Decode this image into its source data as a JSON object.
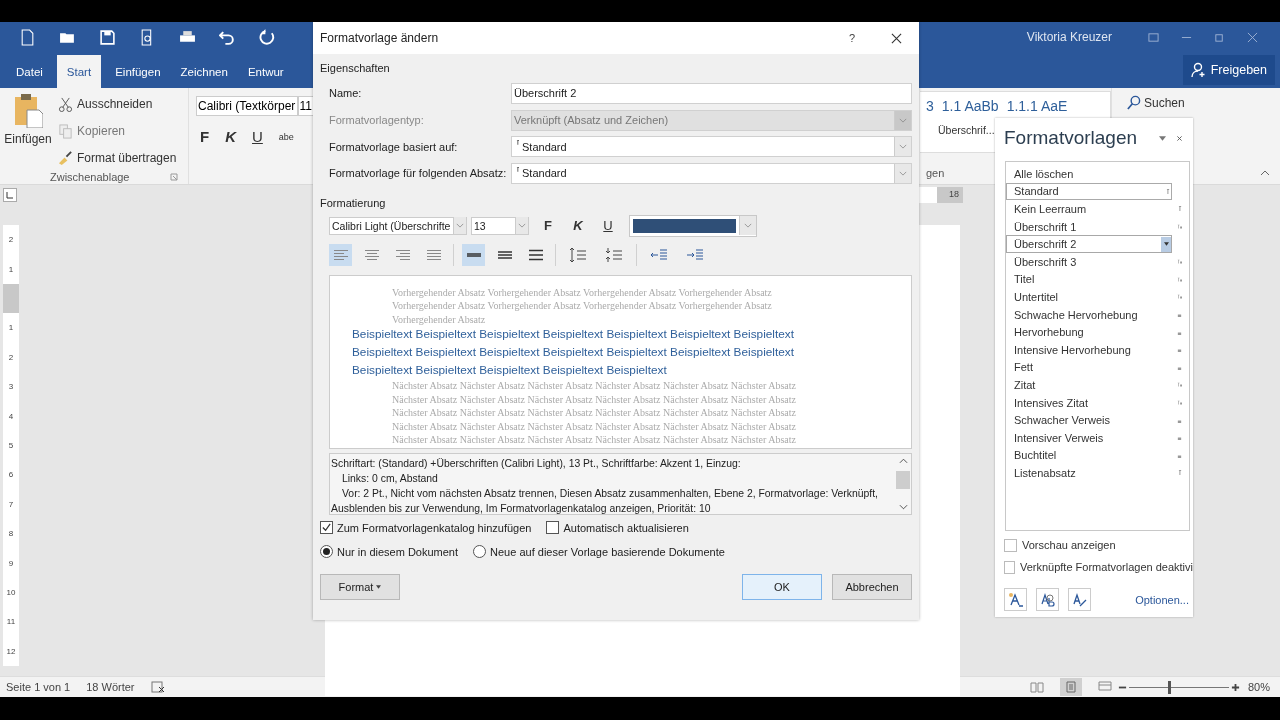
{
  "window": {
    "user": "Viktoria Kreuzer"
  },
  "ribbon_tabs": [
    {
      "label": "Datei",
      "selected": false
    },
    {
      "label": "Start",
      "selected": true
    },
    {
      "label": "Einfügen",
      "selected": false
    },
    {
      "label": "Zeichnen",
      "selected": false
    },
    {
      "label": "Entwur",
      "selected": false
    }
  ],
  "share_button": "Freigeben",
  "clipboard": {
    "paste": "Einfügen",
    "cut": "Ausschneiden",
    "copy": "Kopieren",
    "format_painter": "Format übertragen",
    "group_label": "Zwischenablage"
  },
  "font": {
    "name": "Calibri (Textkörper",
    "size": "11",
    "bold": "F",
    "italic": "K",
    "underline": "U",
    "strikethrough": "abe"
  },
  "style_gallery": {
    "previews": [
      "3",
      "1.1 AaBb",
      "1.1.1 AaE"
    ],
    "caption": "Überschrif...",
    "group_label": "gen"
  },
  "search": "Suchen",
  "ruler": {
    "mark": "18",
    "top_numbers": [
      "2",
      "1"
    ],
    "body_numbers": [
      "1",
      "2",
      "3",
      "4",
      "5",
      "6",
      "7",
      "8",
      "9",
      "10",
      "11",
      "12"
    ]
  },
  "dialog": {
    "title": "Formatvorlage ändern",
    "help": "?",
    "properties_heading": "Eigenschaften",
    "properties": [
      {
        "label": "Name:",
        "value": "Überschrift 2",
        "kind": "text",
        "disabled": false
      },
      {
        "label": "Formatvorlagentyp:",
        "value": "Verknüpft (Absatz und Zeichen)",
        "kind": "select",
        "disabled": true
      },
      {
        "label": "Formatvorlage basiert auf:",
        "value": "Standard",
        "kind": "style-select",
        "disabled": false
      },
      {
        "label": "Formatvorlage für folgenden Absatz:",
        "value": "Standard",
        "kind": "style-select",
        "disabled": false
      }
    ],
    "formatting_heading": "Formatierung",
    "font_name": "Calibri Light (Überschrifte",
    "font_size": "13",
    "bold": "F",
    "italic": "K",
    "underline": "U",
    "alignment_buttons": [
      {
        "kind": "left",
        "selected": true
      },
      {
        "kind": "center",
        "selected": false
      },
      {
        "kind": "right",
        "selected": false
      },
      {
        "kind": "justify",
        "selected": false
      }
    ],
    "spacing_buttons": [
      {
        "kind": "single",
        "selected": true
      },
      {
        "kind": "onehalf",
        "selected": false
      },
      {
        "kind": "double",
        "selected": false
      }
    ],
    "preview": {
      "previous_lines": [
        "Vorhergehender Absatz Vorhergehender Absatz Vorhergehender Absatz Vorhergehender Absatz",
        "Vorhergehender Absatz Vorhergehender Absatz Vorhergehender Absatz Vorhergehender Absatz",
        "Vorhergehender Absatz"
      ],
      "sample_lines": [
        "Beispieltext Beispieltext Beispieltext Beispieltext Beispieltext Beispieltext Beispieltext",
        "Beispieltext Beispieltext Beispieltext Beispieltext Beispieltext Beispieltext Beispieltext",
        "Beispieltext Beispieltext Beispieltext Beispieltext Beispieltext"
      ],
      "next_lines": [
        "Nächster Absatz Nächster Absatz Nächster Absatz Nächster Absatz Nächster Absatz Nächster Absatz",
        "Nächster Absatz Nächster Absatz Nächster Absatz Nächster Absatz Nächster Absatz Nächster Absatz",
        "Nächster Absatz Nächster Absatz Nächster Absatz Nächster Absatz Nächster Absatz Nächster Absatz",
        "Nächster Absatz Nächster Absatz Nächster Absatz Nächster Absatz Nächster Absatz Nächster Absatz",
        "Nächster Absatz Nächster Absatz Nächster Absatz Nächster Absatz Nächster Absatz Nächster Absatz"
      ]
    },
    "description_lines": [
      {
        "text": "Schriftart: (Standard) +Überschriften (Calibri Light), 13 Pt., Schriftfarbe: Akzent 1, Einzug:",
        "kind": "plain"
      },
      {
        "text": "Links:  0 cm, Abstand",
        "kind": "indented"
      },
      {
        "text": "Vor:  2 Pt., Nicht vom nächsten Absatz trennen, Diesen Absatz zusammenhalten, Ebene 2, Formatvorlage: Verknüpft,",
        "kind": "indented"
      },
      {
        "text": "Ausblenden bis zur Verwendung, Im Formatvorlagenkatalog anzeigen, Priorität: 10",
        "kind": "plain"
      }
    ],
    "checkboxes": [
      {
        "label": "Zum Formatvorlagenkatalog hinzufügen",
        "checked": true
      },
      {
        "label": "Automatisch aktualisieren",
        "checked": false
      }
    ],
    "radios": [
      {
        "label": "Nur in diesem Dokument",
        "selected": true
      },
      {
        "label": "Neue auf dieser Vorlage basierende Dokumente",
        "selected": false
      }
    ],
    "format_button": "Format",
    "ok_button": "OK",
    "cancel_button": "Abbrechen"
  },
  "styles_pane": {
    "title": "Formatvorlagen",
    "styles": [
      {
        "name": "Alle löschen",
        "kind": "command",
        "selected": false,
        "hovered": false
      },
      {
        "name": "Standard",
        "kind": "paragraph",
        "selected": false,
        "hovered": true
      },
      {
        "name": "Kein Leerraum",
        "kind": "paragraph",
        "selected": false,
        "hovered": false
      },
      {
        "name": "Überschrift 1",
        "kind": "linked",
        "selected": false,
        "hovered": false
      },
      {
        "name": "Überschrift 2",
        "selected": true,
        "hovered": false
      },
      {
        "name": "Überschrift 3",
        "kind": "linked",
        "selected": false,
        "hovered": false
      },
      {
        "name": "Titel",
        "kind": "linked",
        "selected": false,
        "hovered": false
      },
      {
        "name": "Untertitel",
        "kind": "linked",
        "selected": false,
        "hovered": false
      },
      {
        "name": "Schwache Hervorhebung",
        "kind": "character",
        "selected": false,
        "hovered": false
      },
      {
        "name": "Hervorhebung",
        "kind": "character",
        "selected": false,
        "hovered": false
      },
      {
        "name": "Intensive Hervorhebung",
        "kind": "character",
        "selected": false,
        "hovered": false
      },
      {
        "name": "Fett",
        "kind": "character",
        "selected": false,
        "hovered": false
      },
      {
        "name": "Zitat",
        "kind": "linked",
        "selected": false,
        "hovered": false
      },
      {
        "name": "Intensives Zitat",
        "kind": "linked",
        "selected": false,
        "hovered": false
      },
      {
        "name": "Schwacher Verweis",
        "kind": "character",
        "selected": false,
        "hovered": false
      },
      {
        "name": "Intensiver Verweis",
        "kind": "character",
        "selected": false,
        "hovered": false
      },
      {
        "name": "Buchtitel",
        "kind": "character",
        "selected": false,
        "hovered": false
      },
      {
        "name": "Listenabsatz",
        "kind": "paragraph",
        "selected": false,
        "hovered": false
      }
    ],
    "options": [
      {
        "label": "Vorschau anzeigen",
        "checked": false
      },
      {
        "label": "Verknüpfte Formatvorlagen deaktivi",
        "checked": false
      }
    ],
    "options_link": "Optionen..."
  },
  "status_bar": {
    "page": "Seite 1 von 1",
    "words": "18 Wörter",
    "zoom_slider": {
      "level": 0.4
    },
    "zoom": "80%"
  }
}
